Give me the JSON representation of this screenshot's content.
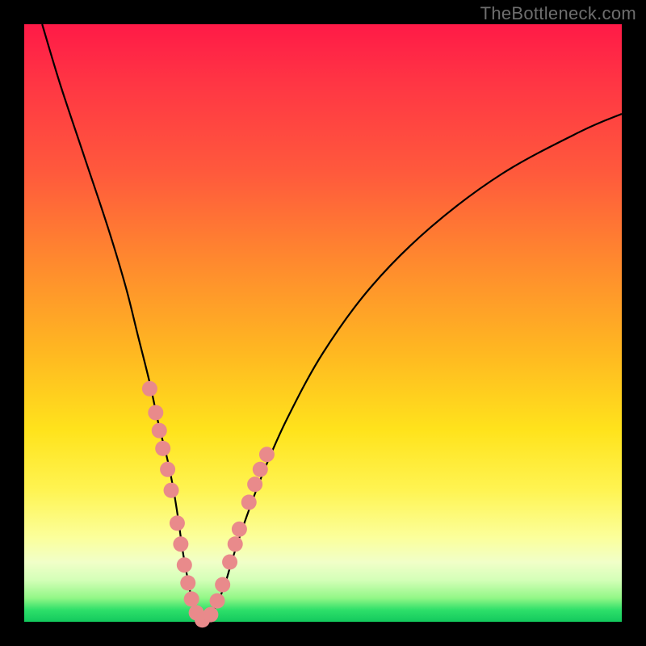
{
  "watermark": "TheBottleneck.com",
  "colors": {
    "curve_stroke": "#000000",
    "dot_fill": "#e98a8b",
    "dot_stroke": "#e98a8b"
  },
  "chart_data": {
    "type": "line",
    "title": "",
    "xlabel": "",
    "ylabel": "",
    "xlim": [
      0,
      100
    ],
    "ylim": [
      0,
      100
    ],
    "series": [
      {
        "name": "bottleneck-curve",
        "x": [
          3,
          6,
          10,
          14,
          17,
          19,
          21,
          22.5,
          24,
          25,
          25.8,
          26.5,
          27.2,
          28,
          29,
          30,
          31,
          32,
          33.5,
          35,
          37,
          40,
          44,
          50,
          58,
          68,
          80,
          93,
          100
        ],
        "y": [
          100,
          90,
          78,
          66,
          56,
          48,
          40,
          33,
          27,
          22,
          17,
          12,
          8,
          4,
          1,
          0,
          0.8,
          2.5,
          6,
          11,
          17,
          25,
          34,
          45,
          56,
          66,
          75,
          82,
          85
        ]
      }
    ],
    "dots": {
      "name": "highlight-dots",
      "points": [
        {
          "x": 21.0,
          "y": 39
        },
        {
          "x": 22.0,
          "y": 35
        },
        {
          "x": 22.6,
          "y": 32
        },
        {
          "x": 23.2,
          "y": 29
        },
        {
          "x": 24.0,
          "y": 25.5
        },
        {
          "x": 24.6,
          "y": 22
        },
        {
          "x": 25.6,
          "y": 16.5
        },
        {
          "x": 26.2,
          "y": 13
        },
        {
          "x": 26.8,
          "y": 9.5
        },
        {
          "x": 27.4,
          "y": 6.5
        },
        {
          "x": 28.0,
          "y": 3.8
        },
        {
          "x": 28.8,
          "y": 1.5
        },
        {
          "x": 29.8,
          "y": 0.3
        },
        {
          "x": 31.2,
          "y": 1.2
        },
        {
          "x": 32.3,
          "y": 3.5
        },
        {
          "x": 33.2,
          "y": 6.2
        },
        {
          "x": 34.4,
          "y": 10
        },
        {
          "x": 35.3,
          "y": 13
        },
        {
          "x": 36.0,
          "y": 15.5
        },
        {
          "x": 37.6,
          "y": 20
        },
        {
          "x": 38.6,
          "y": 23
        },
        {
          "x": 39.5,
          "y": 25.5
        },
        {
          "x": 40.6,
          "y": 28
        }
      ]
    }
  }
}
